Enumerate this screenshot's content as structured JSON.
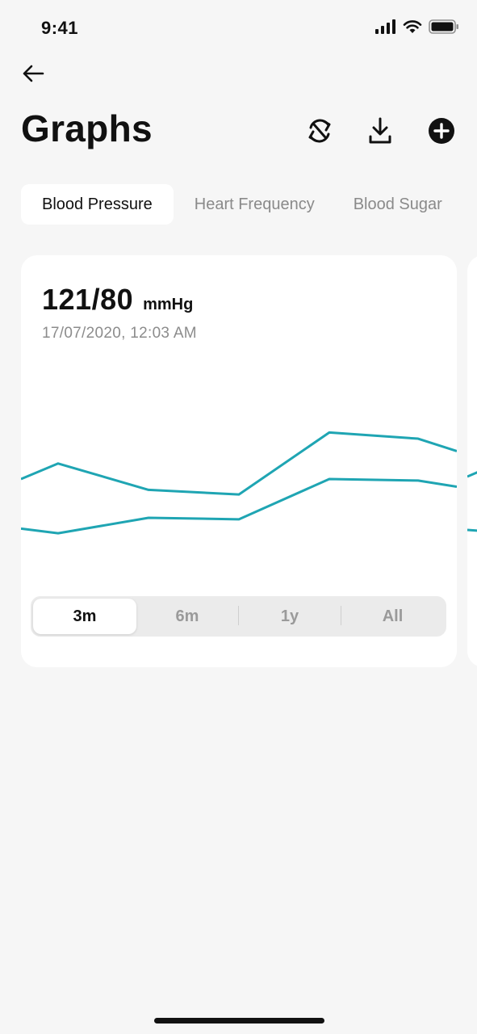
{
  "status_bar": {
    "time": "9:41",
    "signal_icon": "signal-bars-icon",
    "wifi_icon": "wifi-icon",
    "battery_icon": "battery-icon"
  },
  "header": {
    "back_icon": "arrow-left-icon",
    "title": "Graphs",
    "actions": [
      {
        "name": "sync",
        "icon": "sync-icon"
      },
      {
        "name": "download",
        "icon": "download-icon"
      },
      {
        "name": "add",
        "icon": "plus-circle-icon"
      }
    ]
  },
  "tabs": [
    {
      "label": "Blood Pressure",
      "active": true
    },
    {
      "label": "Heart Frequency",
      "active": false
    },
    {
      "label": "Blood Sugar",
      "active": false
    }
  ],
  "card": {
    "value": "121/80",
    "unit": "mmHg",
    "date": "17/07/2020, 12:03 AM"
  },
  "chart_data": {
    "type": "line",
    "title": "",
    "xlabel": "",
    "ylabel": "",
    "grid": false,
    "line_color": "#1fa5b3",
    "x": [
      0,
      1,
      2,
      3,
      4,
      5,
      6
    ],
    "ylim": [
      0,
      100
    ],
    "series": [
      {
        "values": [
          62,
          72,
          55,
          52,
          92,
          88,
          80
        ]
      },
      {
        "values": [
          30,
          27,
          37,
          36,
          62,
          61,
          57
        ]
      }
    ]
  },
  "range": {
    "options": [
      "3m",
      "6m",
      "1y",
      "All"
    ],
    "selected": "3m"
  },
  "colors": {
    "accent": "#1fa5b3",
    "background": "#f6f6f6",
    "card": "#ffffff"
  }
}
